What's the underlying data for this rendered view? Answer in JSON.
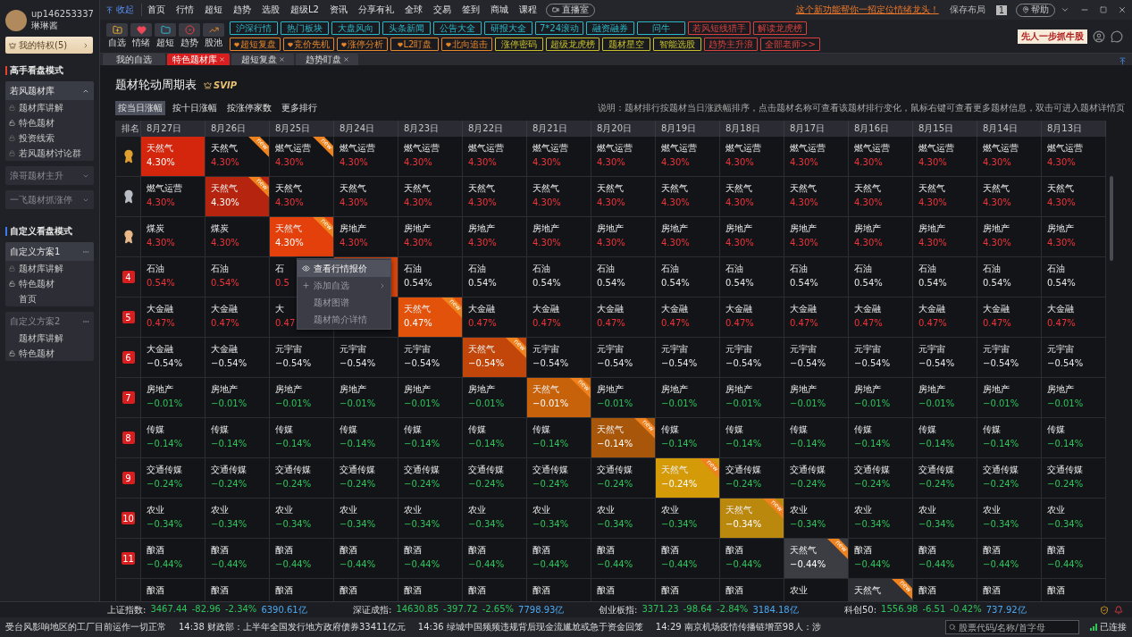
{
  "user": {
    "name": "up146253337",
    "nickname": "琳琳酱",
    "privilege": "我的特权(5)"
  },
  "sidebar": {
    "sections": [
      {
        "title": "高手看盘模式",
        "color": "#e8412c",
        "groups": [
          {
            "title": "若风题材库",
            "kind": "caret",
            "expanded": true,
            "items": [
              {
                "label": "题材库讲解",
                "kind": "locked"
              },
              {
                "label": "特色题材",
                "kind": "unlocked"
              },
              {
                "label": "投资线索",
                "kind": "locked"
              },
              {
                "label": "若风题材讨论群",
                "kind": "locked"
              }
            ]
          },
          {
            "title": "浪哥题材主升",
            "kind": "caret",
            "expanded": false
          },
          {
            "title": "一飞题材抓涨停",
            "kind": "caret",
            "expanded": false
          }
        ]
      },
      {
        "title": "自定义看盘模式",
        "color": "#3a7bf0",
        "groups": [
          {
            "title": "自定义方案1",
            "kind": "dots",
            "expanded": true,
            "items": [
              {
                "label": "题材库讲解",
                "kind": "locked"
              },
              {
                "label": "特色题材",
                "kind": "unlocked"
              },
              {
                "label": "首页",
                "kind": "plain"
              }
            ]
          },
          {
            "title": "自定义方案2",
            "kind": "dots",
            "expanded": false,
            "items": [
              {
                "label": "题材库讲解",
                "kind": "plain"
              },
              {
                "label": "特色题材",
                "kind": "unlocked"
              }
            ]
          }
        ]
      }
    ]
  },
  "topbar": {
    "collapse": "收起",
    "nav": [
      "首页",
      "行情",
      "超短",
      "趋势",
      "选股",
      "超级L2",
      "资讯",
      "分享有礼",
      "全球",
      "交易",
      "签到",
      "商城",
      "课程"
    ],
    "live": "直播室",
    "promo": "这个新功能帮你一招定位情绪龙头！",
    "save": "保存布局",
    "layout_number": "1",
    "help": "帮助"
  },
  "toolbar": {
    "tools": [
      {
        "label": "自选",
        "kind": "folder"
      },
      {
        "label": "情绪",
        "kind": "heart"
      },
      {
        "label": "超短",
        "kind": "chart"
      },
      {
        "label": "趋势",
        "kind": "target"
      },
      {
        "label": "股池",
        "kind": "trend"
      }
    ],
    "tag_rows": [
      [
        {
          "label": "沪深行情",
          "color": "#2ab7c8",
          "kind": "plain"
        },
        {
          "label": "热门板块",
          "color": "#2ab7c8",
          "kind": "plain"
        },
        {
          "label": "大盘风向",
          "color": "#2ab7c8",
          "kind": "plain"
        },
        {
          "label": "头条新闻",
          "color": "#2ab7c8",
          "kind": "plain"
        },
        {
          "label": "公告大全",
          "color": "#2ab7c8",
          "kind": "plain"
        },
        {
          "label": "研报大全",
          "color": "#2ab7c8",
          "kind": "plain"
        },
        {
          "label": "7*24滚动",
          "color": "#2ab7c8",
          "kind": "plain"
        },
        {
          "label": "融资融券",
          "color": "#2ab7c8",
          "kind": "plain"
        },
        {
          "label": "问牛",
          "color": "#2ab7c8",
          "kind": "plain"
        },
        {
          "label": "若风短线猎手",
          "color": "#d8413c",
          "kind": "plain"
        },
        {
          "label": "解读龙虎榜",
          "color": "#d8413c",
          "kind": "plain"
        }
      ],
      [
        {
          "label": "超短复盘",
          "color": "#e8862a",
          "kind": "heart"
        },
        {
          "label": "竞价先机",
          "color": "#e8862a",
          "kind": "heart"
        },
        {
          "label": "涨停分析",
          "color": "#e8862a",
          "kind": "heart"
        },
        {
          "label": "L2盯盘",
          "color": "#e8862a",
          "kind": "heart"
        },
        {
          "label": "北向追击",
          "color": "#e8862a",
          "kind": "heart"
        },
        {
          "label": "涨停密码",
          "color": "#c8c02a",
          "kind": "plain"
        },
        {
          "label": "超级龙虎榜",
          "color": "#c8c02a",
          "kind": "plain"
        },
        {
          "label": "题材星空",
          "color": "#c8c02a",
          "kind": "plain"
        },
        {
          "label": "智能选股",
          "color": "#c8c02a",
          "kind": "plain"
        },
        {
          "label": "趋势主升浪",
          "color": "#d8413c",
          "kind": "plain"
        },
        {
          "label": "全部老师>>",
          "color": "#d8413c",
          "kind": "plain"
        }
      ]
    ],
    "banner": "先人一步抓牛股"
  },
  "tabs": [
    {
      "label": "我的自选",
      "selected": false,
      "closable": false
    },
    {
      "label": "特色题材库",
      "selected": true,
      "closable": true
    },
    {
      "label": "超短复盘",
      "selected": false,
      "closable": true
    },
    {
      "label": "趋势盯盘",
      "selected": false,
      "closable": true
    }
  ],
  "page": {
    "title": "题材轮动周期表",
    "badge": "SVIP",
    "sort_tabs": [
      {
        "label": "按当日涨幅",
        "selected": true
      },
      {
        "label": "按十日涨幅",
        "selected": false
      },
      {
        "label": "按涨停家数",
        "selected": false
      },
      {
        "label": "更多排行",
        "selected": false
      }
    ],
    "note": "说明：题材排行按题材当日涨跌幅排序，点击题材名称可查看该题材排行变化，鼠标右键可查看更多题材信息，双击可进入题材详情页",
    "rank_header": "排名",
    "columns": [
      "8月27日",
      "8月26日",
      "8月25日",
      "8月24日",
      "8月23日",
      "8月22日",
      "8月21日",
      "8月20日",
      "8月19日",
      "8月18日",
      "8月17日",
      "8月16日",
      "8月15日",
      "8月14日",
      "8月13日"
    ],
    "rows": [
      {
        "rank": {
          "kind": "medal",
          "color": "#e0a030"
        },
        "cells": [
          {
            "name": "天然气",
            "pct": "4.30%",
            "kind": "highlight",
            "color": "#d3260c"
          },
          {
            "name": "天然气",
            "pct": "4.30%",
            "kind": "up",
            "badge": "new"
          },
          {
            "name": "燃气运营",
            "pct": "4.30%",
            "kind": "up",
            "badge": "new"
          },
          {
            "name": "燃气运营",
            "pct": "4.30%",
            "kind": "up"
          },
          {
            "name": "燃气运营",
            "pct": "4.30%",
            "kind": "up"
          },
          {
            "name": "燃气运营",
            "pct": "4.30%",
            "kind": "up"
          },
          {
            "name": "燃气运营",
            "pct": "4.30%",
            "kind": "up"
          },
          {
            "name": "燃气运营",
            "pct": "4.30%",
            "kind": "up"
          },
          {
            "name": "燃气运营",
            "pct": "4.30%",
            "kind": "up"
          },
          {
            "name": "燃气运营",
            "pct": "4.30%",
            "kind": "up"
          },
          {
            "name": "燃气运营",
            "pct": "4.30%",
            "kind": "up"
          },
          {
            "name": "燃气运营",
            "pct": "4.30%",
            "kind": "up"
          },
          {
            "name": "燃气运营",
            "pct": "4.30%",
            "kind": "up"
          },
          {
            "name": "燃气运营",
            "pct": "4.30%",
            "kind": "up"
          },
          {
            "name": "燃气运营",
            "pct": "4.30%",
            "kind": "up"
          }
        ]
      },
      {
        "rank": {
          "kind": "medal",
          "color": "#b8bcc4"
        },
        "cells": [
          {
            "name": "燃气运营",
            "pct": "4.30%",
            "kind": "up"
          },
          {
            "name": "天然气",
            "pct": "4.30%",
            "kind": "highlight",
            "color": "#b5240e",
            "badge": "new"
          },
          {
            "name": "天然气",
            "pct": "4.30%",
            "kind": "up"
          },
          {
            "name": "天然气",
            "pct": "4.30%",
            "kind": "up"
          },
          {
            "name": "天然气",
            "pct": "4.30%",
            "kind": "up"
          },
          {
            "name": "天然气",
            "pct": "4.30%",
            "kind": "up"
          },
          {
            "name": "天然气",
            "pct": "4.30%",
            "kind": "up"
          },
          {
            "name": "天然气",
            "pct": "4.30%",
            "kind": "up"
          },
          {
            "name": "天然气",
            "pct": "4.30%",
            "kind": "up"
          },
          {
            "name": "天然气",
            "pct": "4.30%",
            "kind": "up"
          },
          {
            "name": "天然气",
            "pct": "4.30%",
            "kind": "up"
          },
          {
            "name": "天然气",
            "pct": "4.30%",
            "kind": "up"
          },
          {
            "name": "天然气",
            "pct": "4.30%",
            "kind": "up"
          },
          {
            "name": "天然气",
            "pct": "4.30%",
            "kind": "up"
          },
          {
            "name": "天然气",
            "pct": "4.30%",
            "kind": "up"
          }
        ]
      },
      {
        "rank": {
          "kind": "medal",
          "color": "#e8b888"
        },
        "cells": [
          {
            "name": "煤炭",
            "pct": "4.30%",
            "kind": "up"
          },
          {
            "name": "煤炭",
            "pct": "4.30%",
            "kind": "up"
          },
          {
            "name": "天然气",
            "pct": "4.30%",
            "kind": "highlight",
            "color": "#e3400c",
            "badge": "new"
          },
          {
            "name": "房地产",
            "pct": "4.30%",
            "kind": "up"
          },
          {
            "name": "房地产",
            "pct": "4.30%",
            "kind": "up"
          },
          {
            "name": "房地产",
            "pct": "4.30%",
            "kind": "up"
          },
          {
            "name": "房地产",
            "pct": "4.30%",
            "kind": "up"
          },
          {
            "name": "房地产",
            "pct": "4.30%",
            "kind": "up"
          },
          {
            "name": "房地产",
            "pct": "4.30%",
            "kind": "up"
          },
          {
            "name": "房地产",
            "pct": "4.30%",
            "kind": "up"
          },
          {
            "name": "房地产",
            "pct": "4.30%",
            "kind": "up"
          },
          {
            "name": "房地产",
            "pct": "4.30%",
            "kind": "up"
          },
          {
            "name": "房地产",
            "pct": "4.30%",
            "kind": "up"
          },
          {
            "name": "房地产",
            "pct": "4.30%",
            "kind": "up"
          },
          {
            "name": "房地产",
            "pct": "4.30%",
            "kind": "up"
          }
        ]
      },
      {
        "rank": {
          "kind": "number",
          "label": "4"
        },
        "cells": [
          {
            "name": "石油",
            "pct": "0.54%",
            "kind": "up"
          },
          {
            "name": "石油",
            "pct": "0.54%",
            "kind": "up"
          },
          {
            "name": "石",
            "pct": "0.5",
            "kind": "up"
          },
          {
            "kind": "highlight",
            "color": "#d9450c"
          },
          {
            "name": "石油",
            "pct": "0.54%",
            "kind": "flat"
          },
          {
            "name": "石油",
            "pct": "0.54%",
            "kind": "flat"
          },
          {
            "name": "石油",
            "pct": "0.54%",
            "kind": "flat"
          },
          {
            "name": "石油",
            "pct": "0.54%",
            "kind": "flat"
          },
          {
            "name": "石油",
            "pct": "0.54%",
            "kind": "flat"
          },
          {
            "name": "石油",
            "pct": "0.54%",
            "kind": "flat"
          },
          {
            "name": "石油",
            "pct": "0.54%",
            "kind": "flat"
          },
          {
            "name": "石油",
            "pct": "0.54%",
            "kind": "flat"
          },
          {
            "name": "石油",
            "pct": "0.54%",
            "kind": "flat"
          },
          {
            "name": "石油",
            "pct": "0.54%",
            "kind": "flat"
          },
          {
            "name": "石油",
            "pct": "0.54%",
            "kind": "flat"
          }
        ]
      },
      {
        "rank": {
          "kind": "number",
          "label": "5"
        },
        "cells": [
          {
            "name": "大金融",
            "pct": "0.47%",
            "kind": "up"
          },
          {
            "name": "大金融",
            "pct": "0.47%",
            "kind": "up"
          },
          {
            "name": "大",
            "pct": "0.47",
            "kind": "up"
          },
          {
            "kind": "up"
          },
          {
            "name": "天然气",
            "pct": "0.47%",
            "kind": "highlight",
            "color": "#e2520a",
            "badge": "new"
          },
          {
            "name": "大金融",
            "pct": "0.47%",
            "kind": "up"
          },
          {
            "name": "大金融",
            "pct": "0.47%",
            "kind": "up"
          },
          {
            "name": "大金融",
            "pct": "0.47%",
            "kind": "up"
          },
          {
            "name": "大金融",
            "pct": "0.47%",
            "kind": "up"
          },
          {
            "name": "大金融",
            "pct": "0.47%",
            "kind": "up"
          },
          {
            "name": "大金融",
            "pct": "0.47%",
            "kind": "up"
          },
          {
            "name": "大金融",
            "pct": "0.47%",
            "kind": "up"
          },
          {
            "name": "大金融",
            "pct": "0.47%",
            "kind": "up"
          },
          {
            "name": "大金融",
            "pct": "0.47%",
            "kind": "up"
          },
          {
            "name": "大金融",
            "pct": "0.47%",
            "kind": "up"
          }
        ]
      },
      {
        "rank": {
          "kind": "number",
          "label": "6"
        },
        "cells": [
          {
            "name": "大金融",
            "pct": "−0.54%",
            "kind": "flat"
          },
          {
            "name": "大金融",
            "pct": "−0.54%",
            "kind": "flat"
          },
          {
            "name": "元宇宙",
            "pct": "−0.54%",
            "kind": "flat"
          },
          {
            "name": "元宇宙",
            "pct": "−0.54%",
            "kind": "flat"
          },
          {
            "name": "元宇宙",
            "pct": "−0.54%",
            "kind": "flat"
          },
          {
            "name": "天然气",
            "pct": "−0.54%",
            "kind": "highlight",
            "color": "#c2460a",
            "badge": "new"
          },
          {
            "name": "元宇宙",
            "pct": "−0.54%",
            "kind": "flat"
          },
          {
            "name": "元宇宙",
            "pct": "−0.54%",
            "kind": "flat"
          },
          {
            "name": "元宇宙",
            "pct": "−0.54%",
            "kind": "flat"
          },
          {
            "name": "元宇宙",
            "pct": "−0.54%",
            "kind": "flat"
          },
          {
            "name": "元宇宙",
            "pct": "−0.54%",
            "kind": "flat"
          },
          {
            "name": "元宇宙",
            "pct": "−0.54%",
            "kind": "flat"
          },
          {
            "name": "元宇宙",
            "pct": "−0.54%",
            "kind": "flat"
          },
          {
            "name": "元宇宙",
            "pct": "−0.54%",
            "kind": "flat"
          },
          {
            "name": "元宇宙",
            "pct": "−0.54%",
            "kind": "flat"
          }
        ]
      },
      {
        "rank": {
          "kind": "number",
          "label": "7"
        },
        "cells": [
          {
            "name": "房地产",
            "pct": "−0.01%",
            "kind": "down"
          },
          {
            "name": "房地产",
            "pct": "−0.01%",
            "kind": "down"
          },
          {
            "name": "房地产",
            "pct": "−0.01%",
            "kind": "down"
          },
          {
            "name": "房地产",
            "pct": "−0.01%",
            "kind": "down"
          },
          {
            "name": "房地产",
            "pct": "−0.01%",
            "kind": "down"
          },
          {
            "name": "房地产",
            "pct": "−0.01%",
            "kind": "down"
          },
          {
            "name": "天然气",
            "pct": "−0.01%",
            "kind": "highlight",
            "color": "#c8620a",
            "badge": "new"
          },
          {
            "name": "房地产",
            "pct": "−0.01%",
            "kind": "down"
          },
          {
            "name": "房地产",
            "pct": "−0.01%",
            "kind": "down"
          },
          {
            "name": "房地产",
            "pct": "−0.01%",
            "kind": "down"
          },
          {
            "name": "房地产",
            "pct": "−0.01%",
            "kind": "down"
          },
          {
            "name": "房地产",
            "pct": "−0.01%",
            "kind": "down"
          },
          {
            "name": "房地产",
            "pct": "−0.01%",
            "kind": "down"
          },
          {
            "name": "房地产",
            "pct": "−0.01%",
            "kind": "down"
          },
          {
            "name": "房地产",
            "pct": "−0.01%",
            "kind": "down"
          }
        ]
      },
      {
        "rank": {
          "kind": "number",
          "label": "8"
        },
        "cells": [
          {
            "name": "传媒",
            "pct": "−0.14%",
            "kind": "down"
          },
          {
            "name": "传媒",
            "pct": "−0.14%",
            "kind": "down"
          },
          {
            "name": "传媒",
            "pct": "−0.14%",
            "kind": "down"
          },
          {
            "name": "传媒",
            "pct": "−0.14%",
            "kind": "down"
          },
          {
            "name": "传媒",
            "pct": "−0.14%",
            "kind": "down"
          },
          {
            "name": "传媒",
            "pct": "−0.14%",
            "kind": "down"
          },
          {
            "name": "传媒",
            "pct": "−0.14%",
            "kind": "down"
          },
          {
            "name": "天然气",
            "pct": "−0.14%",
            "kind": "highlight",
            "color": "#a8560a",
            "badge": "new"
          },
          {
            "name": "传媒",
            "pct": "−0.14%",
            "kind": "down"
          },
          {
            "name": "传媒",
            "pct": "−0.14%",
            "kind": "down"
          },
          {
            "name": "传媒",
            "pct": "−0.14%",
            "kind": "down"
          },
          {
            "name": "传媒",
            "pct": "−0.14%",
            "kind": "down"
          },
          {
            "name": "传媒",
            "pct": "−0.14%",
            "kind": "down"
          },
          {
            "name": "传媒",
            "pct": "−0.14%",
            "kind": "down"
          },
          {
            "name": "传媒",
            "pct": "−0.14%",
            "kind": "down"
          }
        ]
      },
      {
        "rank": {
          "kind": "number",
          "label": "9"
        },
        "cells": [
          {
            "name": "交通传媒",
            "pct": "−0.24%",
            "kind": "down"
          },
          {
            "name": "交通传媒",
            "pct": "−0.24%",
            "kind": "down"
          },
          {
            "name": "交通传媒",
            "pct": "−0.24%",
            "kind": "down"
          },
          {
            "name": "交通传媒",
            "pct": "−0.24%",
            "kind": "down"
          },
          {
            "name": "交通传媒",
            "pct": "−0.24%",
            "kind": "down"
          },
          {
            "name": "交通传媒",
            "pct": "−0.24%",
            "kind": "down"
          },
          {
            "name": "交通传媒",
            "pct": "−0.24%",
            "kind": "down"
          },
          {
            "name": "交通传媒",
            "pct": "−0.24%",
            "kind": "down"
          },
          {
            "name": "天然气",
            "pct": "−0.24%",
            "kind": "highlight",
            "color": "#d49a08",
            "badge": "new"
          },
          {
            "name": "交通传媒",
            "pct": "−0.24%",
            "kind": "down"
          },
          {
            "name": "交通传媒",
            "pct": "−0.24%",
            "kind": "down"
          },
          {
            "name": "交通传媒",
            "pct": "−0.24%",
            "kind": "down"
          },
          {
            "name": "交通传媒",
            "pct": "−0.24%",
            "kind": "down"
          },
          {
            "name": "交通传媒",
            "pct": "−0.24%",
            "kind": "down"
          },
          {
            "name": "交通传媒",
            "pct": "−0.24%",
            "kind": "down"
          }
        ]
      },
      {
        "rank": {
          "kind": "number",
          "label": "10"
        },
        "cells": [
          {
            "name": "农业",
            "pct": "−0.34%",
            "kind": "down"
          },
          {
            "name": "农业",
            "pct": "−0.34%",
            "kind": "down"
          },
          {
            "name": "农业",
            "pct": "−0.34%",
            "kind": "down"
          },
          {
            "name": "农业",
            "pct": "−0.34%",
            "kind": "down"
          },
          {
            "name": "农业",
            "pct": "−0.34%",
            "kind": "down"
          },
          {
            "name": "农业",
            "pct": "−0.34%",
            "kind": "down"
          },
          {
            "name": "农业",
            "pct": "−0.34%",
            "kind": "down"
          },
          {
            "name": "农业",
            "pct": "−0.34%",
            "kind": "down"
          },
          {
            "name": "农业",
            "pct": "−0.34%",
            "kind": "down"
          },
          {
            "name": "天然气",
            "pct": "−0.34%",
            "kind": "highlight",
            "color": "#bb880e",
            "badge": "new"
          },
          {
            "name": "农业",
            "pct": "−0.34%",
            "kind": "down"
          },
          {
            "name": "农业",
            "pct": "−0.34%",
            "kind": "down"
          },
          {
            "name": "农业",
            "pct": "−0.34%",
            "kind": "down"
          },
          {
            "name": "农业",
            "pct": "−0.34%",
            "kind": "down"
          },
          {
            "name": "农业",
            "pct": "−0.34%",
            "kind": "down"
          }
        ]
      },
      {
        "rank": {
          "kind": "number",
          "label": "11"
        },
        "cells": [
          {
            "name": "酿酒",
            "pct": "−0.44%",
            "kind": "down"
          },
          {
            "name": "酿酒",
            "pct": "−0.44%",
            "kind": "down"
          },
          {
            "name": "酿酒",
            "pct": "−0.44%",
            "kind": "down"
          },
          {
            "name": "酿酒",
            "pct": "−0.44%",
            "kind": "down"
          },
          {
            "name": "酿酒",
            "pct": "−0.44%",
            "kind": "down"
          },
          {
            "name": "酿酒",
            "pct": "−0.44%",
            "kind": "down"
          },
          {
            "name": "酿酒",
            "pct": "−0.44%",
            "kind": "down"
          },
          {
            "name": "酿酒",
            "pct": "−0.44%",
            "kind": "down"
          },
          {
            "name": "酿酒",
            "pct": "−0.44%",
            "kind": "down"
          },
          {
            "name": "酿酒",
            "pct": "−0.44%",
            "kind": "down"
          },
          {
            "name": "天然气",
            "pct": "−0.44%",
            "kind": "highlight",
            "color": "#3c3d42",
            "badge": "new"
          },
          {
            "name": "酿酒",
            "pct": "−0.44%",
            "kind": "down"
          },
          {
            "name": "酿酒",
            "pct": "−0.44%",
            "kind": "down"
          },
          {
            "name": "酿酒",
            "pct": "−0.44%",
            "kind": "down"
          },
          {
            "name": "酿酒",
            "pct": "−0.44%",
            "kind": "down"
          }
        ]
      },
      {
        "cells": [
          {
            "name": "酿酒",
            "kind": "down"
          },
          {
            "name": "酿酒",
            "kind": "down"
          },
          {
            "name": "酿酒",
            "kind": "down"
          },
          {
            "name": "酿酒",
            "kind": "down"
          },
          {
            "name": "酿酒",
            "kind": "down"
          },
          {
            "name": "酿酒",
            "kind": "down"
          },
          {
            "name": "酿酒",
            "kind": "down"
          },
          {
            "name": "酿酒",
            "kind": "down"
          },
          {
            "name": "酿酒",
            "kind": "down"
          },
          {
            "name": "酿酒",
            "kind": "down"
          },
          {
            "name": "农业",
            "kind": "down"
          },
          {
            "name": "天然气",
            "kind": "highlight",
            "color": "#2e2f34",
            "badge": "new"
          },
          {
            "name": "酿酒",
            "kind": "down"
          },
          {
            "name": "酿酒",
            "kind": "down"
          },
          {
            "name": "酿酒",
            "kind": "down"
          }
        ]
      }
    ],
    "context_menu": [
      {
        "label": "查看行情报价",
        "kind": "eye",
        "selected": true,
        "submenu": false
      },
      {
        "label": "添加自选",
        "kind": "plus",
        "selected": false,
        "submenu": true
      },
      {
        "label": "题材图谱",
        "kind": "plain",
        "selected": false,
        "submenu": false
      },
      {
        "label": "题材简介详情",
        "kind": "plain",
        "selected": false,
        "submenu": false
      }
    ]
  },
  "indices": [
    {
      "name": "上证指数:",
      "price": "3467.44",
      "change": "-82.96",
      "pct": "-2.34%",
      "amount": "6390.61亿"
    },
    {
      "name": "深证成指:",
      "price": "14630.85",
      "change": "-397.72",
      "pct": "-2.65%",
      "amount": "7798.93亿"
    },
    {
      "name": "创业板指:",
      "price": "3371.23",
      "change": "-98.64",
      "pct": "-2.84%",
      "amount": "3184.18亿"
    },
    {
      "name": "科创50:",
      "price": "1556.98",
      "change": "-6.51",
      "pct": "-0.42%",
      "amount": "737.92亿"
    }
  ],
  "news": [
    "受台风影响地区的工厂目前运作一切正常",
    "14:38 财政部：上半年全国发行地方政府债券33411亿元",
    "14:36 绿城中国频频违规背后现金流尴尬或急于资金回笼",
    "14:29 南京机场疫情传播链增至98人：涉"
  ],
  "search": {
    "placeholder": "股票代码/名称/首字母"
  },
  "connection": "已连接"
}
